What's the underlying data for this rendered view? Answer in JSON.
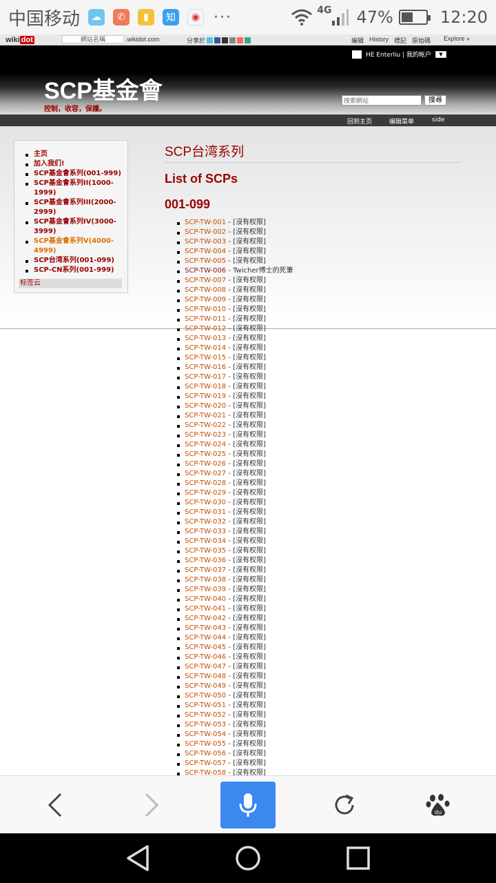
{
  "status_bar": {
    "carrier": "中国移动",
    "more": "···",
    "network": "4G",
    "battery": "47%",
    "battery_level": 0.47,
    "time": "12:20"
  },
  "wikidot_bar": {
    "logo_a": "wiki",
    "logo_b": "dot",
    "site_name_placeholder": "網站名稱",
    "domain": ".wikidot.com",
    "share_label": "分享於",
    "links": [
      "编辑",
      "History",
      "標記",
      "原始碼"
    ],
    "explore": "Explore »"
  },
  "header": {
    "site_title": "SCP基金會",
    "slogan": "控制，收容，保護。",
    "account_text": "HE Enterliu | 我的帐户",
    "search_placeholder": "搜索網站",
    "search_button": "搜尋"
  },
  "top_nav": [
    "回到主页",
    "编辑菜单",
    "side"
  ],
  "sidebar": {
    "items": [
      {
        "label": "主页",
        "color": "#990000"
      },
      {
        "label": "加入我们!",
        "color": "#990000"
      },
      {
        "label": "SCP基金會系列(001-999)",
        "color": "#990000"
      },
      {
        "label": "SCP基金會系列II(1000-1999)",
        "color": "#990000"
      },
      {
        "label": "SCP基金會系列III(2000-2999)",
        "color": "#990000"
      },
      {
        "label": "SCP基金會系列IV(3000-3999)",
        "color": "#990000"
      },
      {
        "label": "SCP基金會系列V(4000-4999)",
        "color": "#e07000"
      },
      {
        "label": "SCP台湾系列(001-099)",
        "color": "#990000"
      },
      {
        "label": "SCP-CN系列(001-999)",
        "color": "#990000"
      }
    ],
    "tag_cloud": "标签云"
  },
  "main": {
    "page_title": "SCP台湾系列",
    "heading_list": "List of SCPs",
    "heading_range": "001-099",
    "entries": [
      {
        "id": "SCP-TW-001",
        "desc": " - [沒有权限]"
      },
      {
        "id": "SCP-TW-002",
        "desc": " - [沒有权限]"
      },
      {
        "id": "SCP-TW-003",
        "desc": " - [沒有权限]"
      },
      {
        "id": "SCP-TW-004",
        "desc": " - [沒有权限]"
      },
      {
        "id": "SCP-TW-005",
        "desc": " - [沒有权限]"
      },
      {
        "id": "SCP-TW-006",
        "desc": " - Twicher博士的死筆",
        "dark": true
      },
      {
        "id": "SCP-TW-007",
        "desc": " - [沒有权限]"
      },
      {
        "id": "SCP-TW-008",
        "desc": " - [沒有权限]"
      },
      {
        "id": "SCP-TW-009",
        "desc": " - [沒有权限]"
      },
      {
        "id": "SCP-TW-010",
        "desc": " - [沒有权限]"
      },
      {
        "id": "SCP-TW-011",
        "desc": " - [沒有权限]"
      },
      {
        "id": "SCP-TW-012",
        "desc": " - [沒有权限]"
      },
      {
        "id": "SCP-TW-013",
        "desc": " - [沒有权限]"
      },
      {
        "id": "SCP-TW-014",
        "desc": " - [沒有权限]"
      },
      {
        "id": "SCP-TW-015",
        "desc": " - [沒有权限]"
      },
      {
        "id": "SCP-TW-016",
        "desc": " - [沒有权限]"
      },
      {
        "id": "SCP-TW-017",
        "desc": " - [沒有权限]"
      },
      {
        "id": "SCP-TW-018",
        "desc": " - [沒有权限]"
      },
      {
        "id": "SCP-TW-019",
        "desc": " - [沒有权限]"
      },
      {
        "id": "SCP-TW-020",
        "desc": " - [沒有权限]"
      },
      {
        "id": "SCP-TW-021",
        "desc": " - [沒有权限]"
      },
      {
        "id": "SCP-TW-022",
        "desc": " - [沒有权限]"
      },
      {
        "id": "SCP-TW-023",
        "desc": " - [沒有权限]"
      },
      {
        "id": "SCP-TW-024",
        "desc": " - [沒有权限]"
      },
      {
        "id": "SCP-TW-025",
        "desc": " - [沒有权限]"
      },
      {
        "id": "SCP-TW-026",
        "desc": " - [沒有权限]"
      },
      {
        "id": "SCP-TW-027",
        "desc": " - [沒有权限]"
      },
      {
        "id": "SCP-TW-028",
        "desc": " - [沒有权限]"
      },
      {
        "id": "SCP-TW-029",
        "desc": " - [沒有权限]"
      },
      {
        "id": "SCP-TW-030",
        "desc": " - [沒有权限]"
      },
      {
        "id": "SCP-TW-031",
        "desc": " - [沒有权限]"
      },
      {
        "id": "SCP-TW-032",
        "desc": " - [沒有权限]"
      },
      {
        "id": "SCP-TW-033",
        "desc": " - [沒有权限]"
      },
      {
        "id": "SCP-TW-034",
        "desc": " - [沒有权限]"
      },
      {
        "id": "SCP-TW-035",
        "desc": " - [沒有权限]"
      },
      {
        "id": "SCP-TW-036",
        "desc": " - [沒有权限]"
      },
      {
        "id": "SCP-TW-037",
        "desc": " - [沒有权限]"
      },
      {
        "id": "SCP-TW-038",
        "desc": " - [沒有权限]"
      },
      {
        "id": "SCP-TW-039",
        "desc": " - [沒有权限]"
      },
      {
        "id": "SCP-TW-040",
        "desc": " - [沒有权限]"
      },
      {
        "id": "SCP-TW-041",
        "desc": " - [沒有权限]"
      },
      {
        "id": "SCP-TW-042",
        "desc": " - [沒有权限]"
      },
      {
        "id": "SCP-TW-043",
        "desc": " - [沒有权限]"
      },
      {
        "id": "SCP-TW-044",
        "desc": " - [沒有权限]"
      },
      {
        "id": "SCP-TW-045",
        "desc": " - [沒有权限]"
      },
      {
        "id": "SCP-TW-046",
        "desc": " - [沒有权限]"
      },
      {
        "id": "SCP-TW-047",
        "desc": " - [沒有权限]"
      },
      {
        "id": "SCP-TW-048",
        "desc": " - [沒有权限]"
      },
      {
        "id": "SCP-TW-049",
        "desc": " - [沒有权限]"
      },
      {
        "id": "SCP-TW-050",
        "desc": " - [沒有权限]"
      },
      {
        "id": "SCP-TW-051",
        "desc": " - [沒有权限]"
      },
      {
        "id": "SCP-TW-052",
        "desc": " - [沒有权限]"
      },
      {
        "id": "SCP-TW-053",
        "desc": " - [沒有权限]"
      },
      {
        "id": "SCP-TW-054",
        "desc": " - [沒有权限]"
      },
      {
        "id": "SCP-TW-055",
        "desc": " - [沒有权限]"
      },
      {
        "id": "SCP-TW-056",
        "desc": " - [沒有权限]"
      },
      {
        "id": "SCP-TW-057",
        "desc": " - [沒有权限]"
      },
      {
        "id": "SCP-TW-058",
        "desc": " - [沒有权限]"
      }
    ]
  },
  "browser_toolbar": {
    "icons": [
      "back-icon",
      "forward-icon",
      "microphone-icon",
      "refresh-icon",
      "baidu-paw-icon"
    ],
    "mic_color": "#3a88f0"
  },
  "nav_bar": {
    "icons": [
      "nav-back-icon",
      "nav-home-icon",
      "nav-recents-icon"
    ]
  }
}
